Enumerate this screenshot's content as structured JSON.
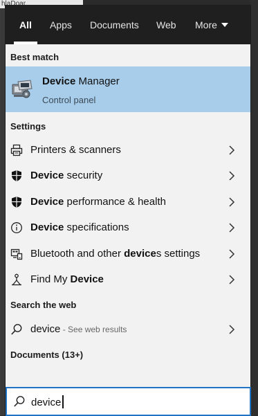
{
  "background": {
    "top_left_text": "hlaDoar"
  },
  "tabs": [
    {
      "label": "All",
      "active": true
    },
    {
      "label": "Apps"
    },
    {
      "label": "Documents"
    },
    {
      "label": "Web"
    },
    {
      "label": "More"
    }
  ],
  "best_match": {
    "header": "Best match",
    "title_bold": "Device",
    "title_rest": " Manager",
    "subtitle": "Control panel",
    "icon": "device-manager-icon"
  },
  "settings": {
    "header": "Settings",
    "items": [
      {
        "pre": "",
        "bold": "",
        "post": "Printers & scanners",
        "icon": "printer-icon"
      },
      {
        "pre": "",
        "bold": "Device",
        "post": " security",
        "icon": "shield-icon"
      },
      {
        "pre": "",
        "bold": "Device",
        "post": " performance & health",
        "icon": "shield-icon"
      },
      {
        "pre": "",
        "bold": "Device",
        "post": " specifications",
        "icon": "info-icon"
      },
      {
        "pre": "Bluetooth and other ",
        "bold": "device",
        "post": "s settings",
        "icon": "bluetooth-devices-icon"
      },
      {
        "pre": "Find My ",
        "bold": "Device",
        "post": "",
        "icon": "find-my-device-icon"
      }
    ]
  },
  "web": {
    "header": "Search the web",
    "query": "device",
    "suffix": " - See web results"
  },
  "documents": {
    "header": "Documents (13+)"
  },
  "search": {
    "value": "device"
  },
  "colors": {
    "selected_bg": "#a8cdea",
    "topbar_bg": "#1f1f1f",
    "searchbox_border": "#1f73c4"
  }
}
